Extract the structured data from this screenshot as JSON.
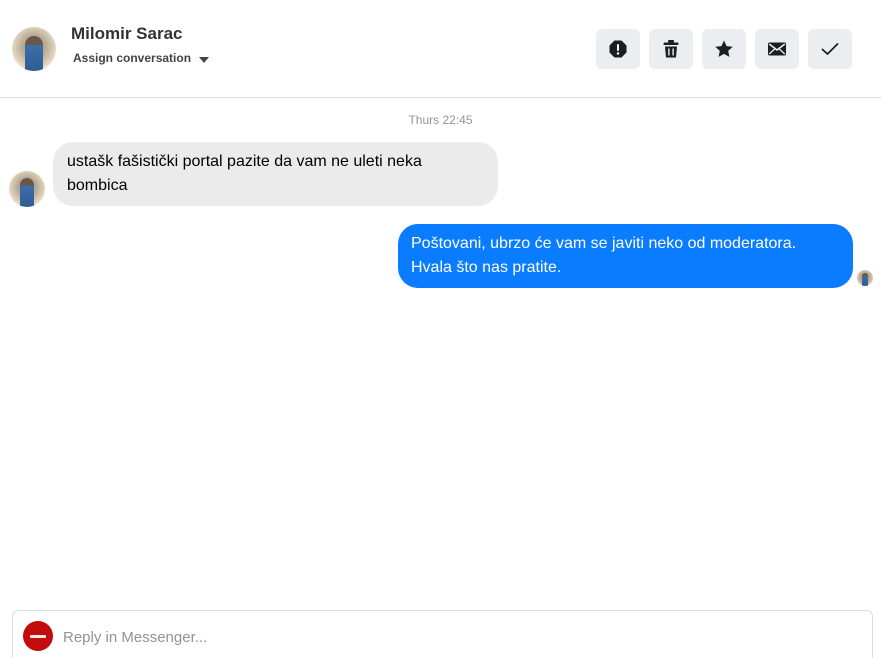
{
  "header": {
    "contact_name": "Milomir Sarac",
    "assign_label": "Assign conversation",
    "actions": [
      {
        "icon": "alert-icon",
        "label": "Mark as spam"
      },
      {
        "icon": "trash-icon",
        "label": "Delete"
      },
      {
        "icon": "star-icon",
        "label": "Star"
      },
      {
        "icon": "envelope-icon",
        "label": "Mark as unread"
      },
      {
        "icon": "check-icon",
        "label": "Mark as done"
      }
    ]
  },
  "conversation": {
    "timestamp": "Thurs 22:45",
    "messages": [
      {
        "direction": "incoming",
        "text": "ustašk fašistički portal pazite da vam ne uleti neka bombica"
      },
      {
        "direction": "outgoing",
        "text": "Poštovani, ubrzo će vam se javiti neko od moderatora. Hvala što nas pratite."
      }
    ]
  },
  "composer": {
    "placeholder": "Reply in Messenger..."
  },
  "colors": {
    "outgoing_bubble": "#0a7cff",
    "incoming_bubble": "#ebebeb",
    "page_logo": "#c30c0c"
  }
}
